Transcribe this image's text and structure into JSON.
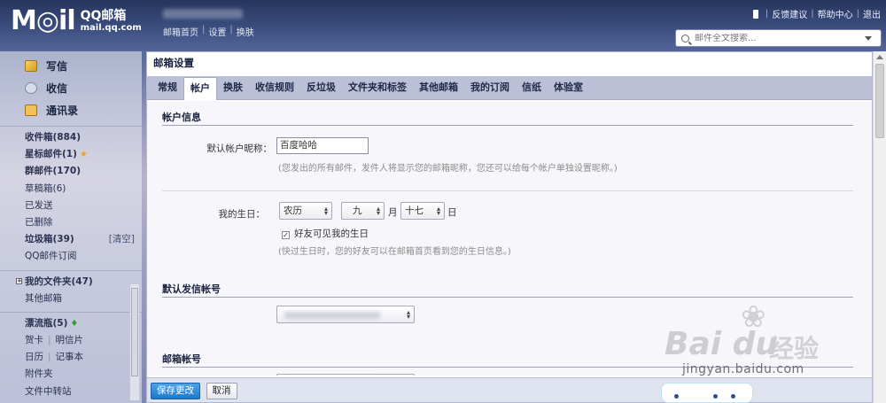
{
  "header": {
    "logo_mark": "M◎il",
    "logo_cn": "QQ邮箱",
    "logo_url": "mail.qq.com",
    "nav": [
      "邮箱首页",
      "设置",
      "换肤"
    ],
    "links": [
      "反馈建议",
      "帮助中心",
      "退出"
    ],
    "search_placeholder": "邮件全文搜索..."
  },
  "sidebar": {
    "actions": [
      {
        "label": "写信",
        "icon": "pencil-icon"
      },
      {
        "label": "收信",
        "icon": "inbox-icon"
      },
      {
        "label": "通讯录",
        "icon": "address-book-icon"
      }
    ],
    "folders": [
      {
        "label": "收件箱(884)",
        "bold": true
      },
      {
        "label": "星标邮件(1)",
        "bold": true,
        "icon": "star-icon"
      },
      {
        "label": "群邮件(170)",
        "bold": true
      },
      {
        "label": "草稿箱(6)"
      },
      {
        "label": "已发送"
      },
      {
        "label": "已删除"
      },
      {
        "label": "垃圾箱(39)",
        "bold": true,
        "action": "[清空]"
      },
      {
        "label": "QQ邮件订阅"
      }
    ],
    "my_folders": "我的文件夹(47)",
    "other_mailbox": "其他邮箱",
    "drift_bottle": "漂流瓶(5)",
    "cards": [
      "贺卡",
      "明信片"
    ],
    "calendar": [
      "日历",
      "记事本"
    ],
    "attachments": "附件夹",
    "file_transfer": "文件中转站"
  },
  "main": {
    "title": "邮箱设置",
    "tabs": [
      "常规",
      "帐户",
      "换肤",
      "收信规则",
      "反垃圾",
      "文件夹和标签",
      "其他邮箱",
      "我的订阅",
      "信纸",
      "体验室"
    ],
    "active_tab": "帐户",
    "account_info": {
      "heading": "帐户信息",
      "nickname_label": "默认帐户昵称：",
      "nickname_value": "百度哈哈",
      "nickname_hint": "(您发出的所有邮件，发件人将显示您的邮箱昵称，您还可以给每个帐户单独设置昵称。)"
    },
    "birthday": {
      "label": "我的生日：",
      "calendar": "农历",
      "month": "九",
      "month_unit": "月",
      "day": "十七",
      "day_unit": "日",
      "visible_checkbox": "好友可见我的生日",
      "visible_checked": true,
      "hint": "(快过生日时，您的好友可以在邮箱首页看到您的生日信息。)"
    },
    "default_sender": {
      "heading": "默认发信帐号"
    },
    "mailbox_account": {
      "heading": "邮箱帐号"
    },
    "buttons": {
      "save": "保存更改",
      "cancel": "取消"
    }
  },
  "watermark": {
    "brand": "Bai du",
    "brand_cn": "经验",
    "url": "jingyan.baidu.com"
  },
  "colors": {
    "header_bg": "#3a4c7c",
    "tab_bar": "#bcc0d7",
    "primary_button": "#1f78c8",
    "accent_star": "#e8a41e"
  }
}
